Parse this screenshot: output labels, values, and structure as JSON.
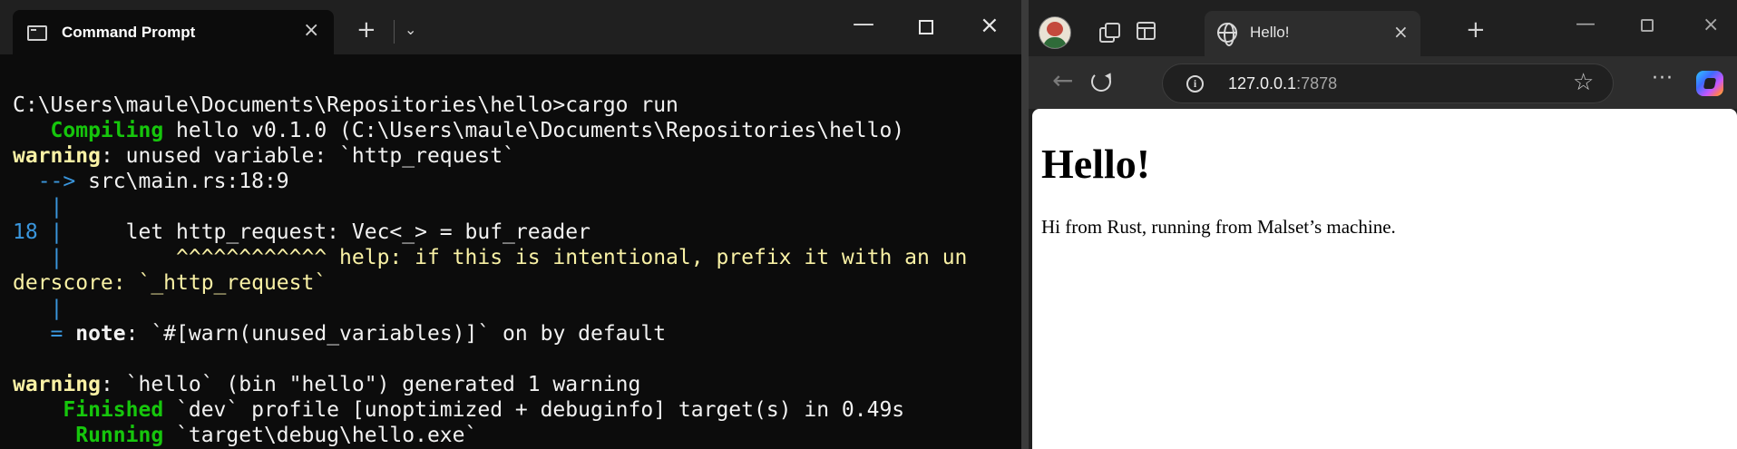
{
  "terminal": {
    "tab_title": "Command Prompt",
    "tab_close": "×",
    "new_tab": "+",
    "dropdown": "⌄",
    "window_controls": {
      "minimize": "—",
      "close": "×"
    },
    "icon": "terminal-icon",
    "lines": {
      "l1": "C:\\Users\\maule\\Documents\\Repositories\\hello>cargo run",
      "l2a": "   Compiling",
      "l2b": " hello v0.1.0 (C:\\Users\\maule\\Documents\\Repositories\\hello)",
      "l3a": "warning",
      "l3b": ": unused variable: `http_request`",
      "l4a": "  -->",
      "l4b": " src\\main.rs:18:9",
      "l5": "   |",
      "l6a": "18 |",
      "l6b": "     let http_request: Vec<_> = buf_reader",
      "l7a": "   |",
      "l7b": "         ^^^^^^^^^^^^ help: if this is intentional, prefix it with an un",
      "l8": "derscore: `_http_request`",
      "l9": "   |",
      "l10a": "   =",
      "l10b": " note",
      "l10c": ": `#[warn(unused_variables)]` on by default",
      "l11": "",
      "l12a": "warning",
      "l12b": ": `hello` (bin \"hello\") generated 1 warning",
      "l13a": "    Finished",
      "l13b": " `dev` profile [unoptimized + debuginfo] target(s) in 0.49s",
      "l14a": "     Running",
      "l14b": " `target\\debug\\hello.exe`"
    }
  },
  "browser": {
    "tab_title": "Hello!",
    "tab_close": "×",
    "new_tab": "+",
    "window_controls": {
      "minimize": "—",
      "close": "×"
    },
    "url_host": "127.0.0.1",
    "url_port": ":7878",
    "info_icon": "i",
    "favorite_icon": "☆",
    "more_icon": "···",
    "back_icon": "←",
    "page": {
      "heading": "Hello!",
      "paragraph": "Hi from Rust, running from Malset’s machine."
    }
  },
  "colors": {
    "terminal_bg": "#0c0c0c",
    "green": "#16c60c",
    "yellow": "#f9f1a5",
    "cyan": "#3a96dd",
    "browser_chrome": "#202020"
  }
}
